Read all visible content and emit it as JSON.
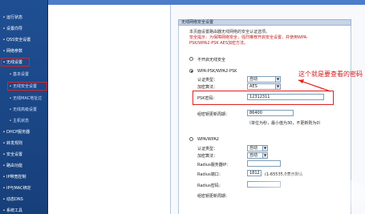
{
  "sidebar": {
    "items": [
      {
        "label": "运行状态"
      },
      {
        "label": "设置向导"
      },
      {
        "label": "QSS安全设置"
      },
      {
        "label": "网络参数"
      },
      {
        "label": "无线设置"
      },
      {
        "label": "基本设置"
      },
      {
        "label": "无线安全设置"
      },
      {
        "label": "无线MAC地址过"
      },
      {
        "label": "无线高级设置"
      },
      {
        "label": "主机状态"
      },
      {
        "label": "DHCP服务器"
      },
      {
        "label": "转发规则"
      },
      {
        "label": "安全设置"
      },
      {
        "label": "路由功能"
      },
      {
        "label": "IP带宽控制"
      },
      {
        "label": "IP与MAC绑定"
      },
      {
        "label": "动态DNS"
      },
      {
        "label": "系统工具"
      }
    ]
  },
  "panel": {
    "title": "无线网络安全设置",
    "notes": [
      "本页面设置路由器无线网络的安全认证选项。",
      "安全提示：为保障网络安全，强烈推荐开启安全设置，并使用WPA-",
      "PSK/WPA2-PSK AES加密方法。"
    ],
    "option_off": "不开启无线安全",
    "option_psk": "WPA-PSK/WPA2-PSK",
    "auth_label": "认证类型：",
    "auth_value": "自动",
    "enc_label": "加密算法：",
    "enc_value": "AES",
    "psk_label": "PSK密码：",
    "psk_value": "12312311",
    "rekey_label": "组密钥更新周期：",
    "rekey_value": "86400",
    "rekey_hint": "（单位为秒，最小值为30，不更新则为0）",
    "option_wpa": "WPA/WPA2",
    "auth2_label": "认证类型：",
    "auth2_value": "自动",
    "enc2_label": "加密算法：",
    "enc2_value": "自动",
    "radius_ip_label": "Radius服务器IP：",
    "radius_port_label": "Radius端口：",
    "radius_port_value": "1812",
    "radius_port_hint": "(1-65535,0表示默认",
    "radius_pwd_label": "Radius密码：",
    "rekey2_label": "组密钥更新周期："
  },
  "callout": "这个就是要查看的密码",
  "colors": {
    "sidebar": "#1f4f93",
    "highlight": "#e02020",
    "callout": "#d01c1c"
  }
}
